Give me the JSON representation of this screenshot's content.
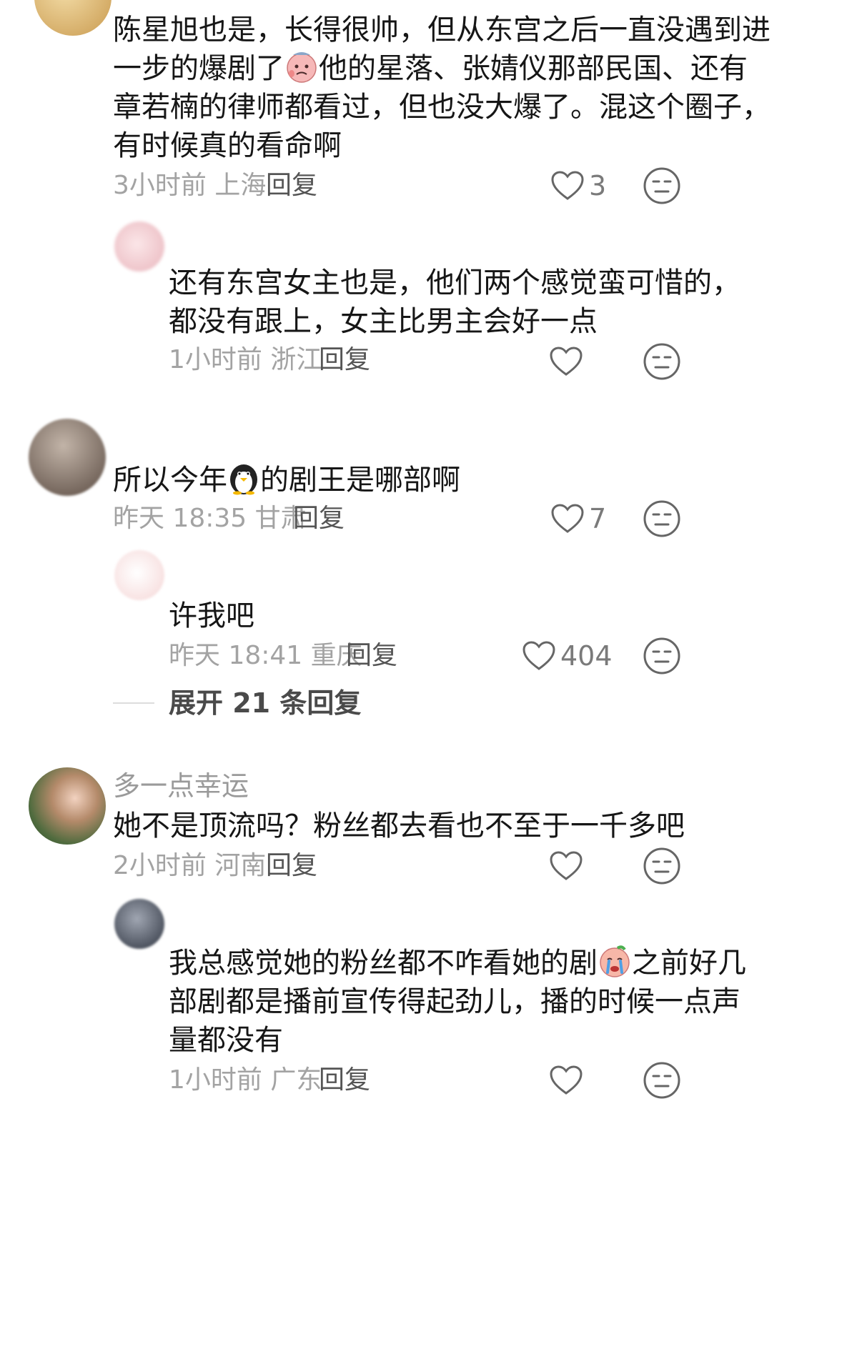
{
  "comments": [
    {
      "username": "",
      "lines": [
        "陈星旭也是，长得很帅，但从东宫之后一直没遇到进",
        [
          "一步的爆剧了",
          "他的星落、张婧仪那部民国、还有"
        ],
        "章若楠的律师都看过，但也没大爆了。混这个圈子，",
        "有时候真的看命啊"
      ],
      "time": "3小时前 上海",
      "reply_label": "回复",
      "like_count": "3",
      "colors": {
        "avatar": "#d9b36a"
      }
    },
    {
      "username": "",
      "lines": [
        "还有东宫女主也是，他们两个感觉蛮可惜的，",
        "都没有跟上，女主比男主会好一点"
      ],
      "time": "1小时前 浙江",
      "reply_label": "回复",
      "like_count": "",
      "colors": {
        "avatar": "#f0c8cc"
      }
    },
    {
      "username": "",
      "lines": [
        [
          "所以今年",
          "的剧王是哪部啊"
        ]
      ],
      "time": "昨天 18:35 甘肃",
      "reply_label": "回复",
      "like_count": "7",
      "colors": {
        "avatar": "#8c7c70"
      }
    },
    {
      "username": "",
      "lines": [
        "许我吧"
      ],
      "time": "昨天 18:41 重庆",
      "reply_label": "回复",
      "like_count": "404",
      "colors": {
        "avatar": "#f7dede"
      }
    },
    {
      "username": "多一点幸运",
      "lines": [
        "她不是顶流吗？粉丝都去看也不至于一千多吧"
      ],
      "time": "2小时前 河南",
      "reply_label": "回复",
      "like_count": "",
      "colors": {
        "avatar": "#6b8a5a"
      }
    },
    {
      "username": "",
      "lines": [
        [
          "我总感觉她的粉丝都不咋看她的剧",
          "之前好几"
        ],
        "部剧都是播前宣传得起劲儿，播的时候一点声",
        "量都没有"
      ],
      "time": "1小时前 广东",
      "reply_label": "回复",
      "like_count": "",
      "colors": {
        "avatar": "#4a4f5a"
      }
    }
  ],
  "expand_replies_label": "展开 21 条回复",
  "icons": {
    "like": "heart-outline-icon",
    "dislike": "neutral-face-icon",
    "emoji_sweat": "sweat-face-emoji-icon",
    "emoji_penguin": "penguin-emoji-icon",
    "emoji_crying": "crying-face-emoji-icon"
  },
  "colors": {
    "text": "#161616",
    "meta": "#a3a3a3",
    "icon": "#666666"
  }
}
